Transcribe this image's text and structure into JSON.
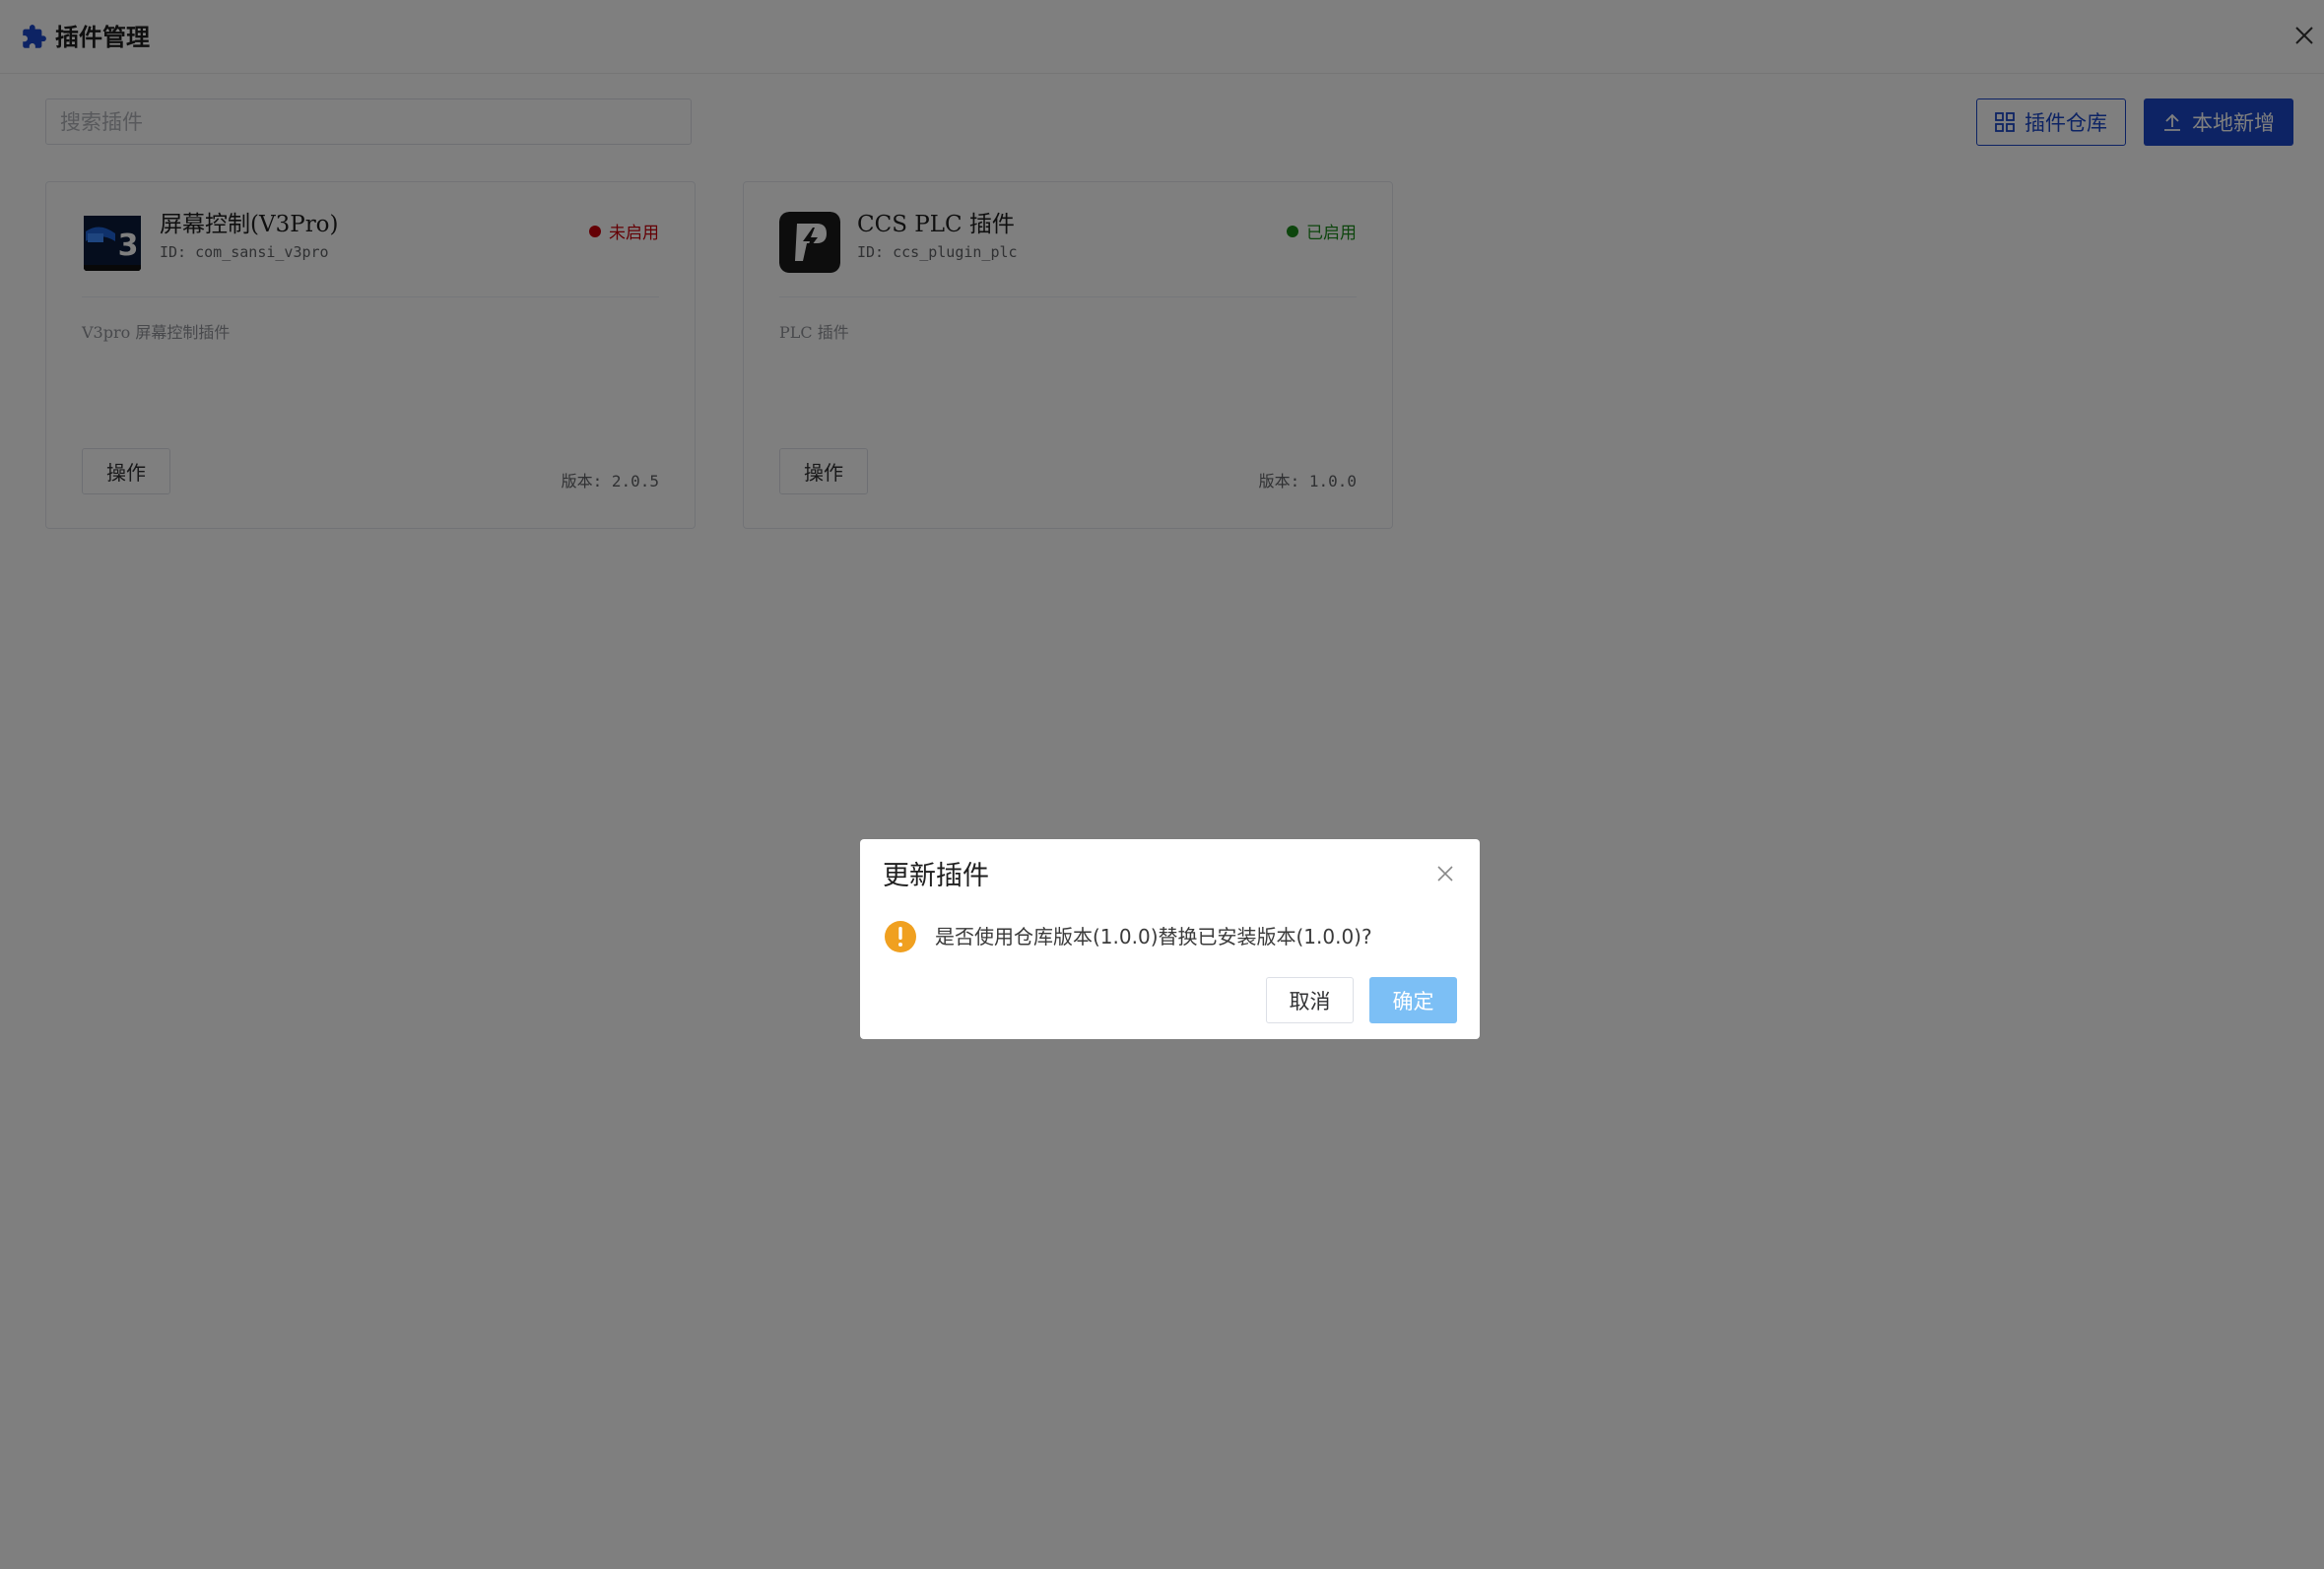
{
  "header": {
    "title": "插件管理",
    "icon": "puzzle-icon",
    "close_icon": "close-icon"
  },
  "toolbar": {
    "search_placeholder": "搜索插件",
    "search_value": "",
    "repo_button_label": "插件仓库",
    "repo_button_icon": "grid-icon",
    "local_add_label": "本地新增",
    "local_add_icon": "upload-icon"
  },
  "plugins": [
    {
      "name": "屏幕控制(V3Pro)",
      "id": "ID: com_sansi_v3pro",
      "status": "未启用",
      "status_color": "#c8000a",
      "description": "V3pro 屏幕控制插件",
      "action_label": "操作",
      "version": "版本: 2.0.5",
      "icon": "v3-pro-icon",
      "icon_text": "3"
    },
    {
      "name": "CCS PLC 插件",
      "id": "ID: ccs_plugin_plc",
      "status": "已启用",
      "status_color": "#1a8a1a",
      "description": "PLC 插件",
      "action_label": "操作",
      "version": "版本: 1.0.0",
      "icon": "plc-lightning-icon"
    }
  ],
  "dialog": {
    "title": "更新插件",
    "message": "是否使用仓库版本(1.0.0)替换已安装版本(1.0.0)?",
    "cancel_label": "取消",
    "confirm_label": "确定",
    "warning_icon": "warning-icon"
  },
  "colors": {
    "primary": "#1a46c8",
    "confirm_button": "#7cbff5",
    "warning": "#f0a020",
    "overlay": "rgba(0,0,0,0.5)"
  }
}
